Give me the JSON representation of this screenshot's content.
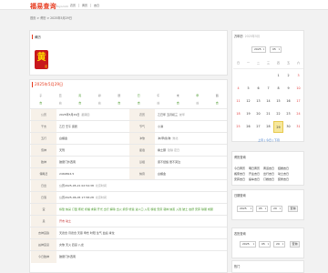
{
  "site": {
    "logo": "福易查询",
    "logo_sub": "fuyi.com",
    "nav": [
      "农历",
      "黄历",
      "吉日"
    ]
  },
  "breadcrumb": "首页 > 黄历 > 2025年5月29日",
  "header": {
    "title": "黄历",
    "badge_main": "黄",
    "badge_sub": "历",
    "text": "农历日历 今日宜忌 吉时凶时 彭祖百忌 胎神占方 五行纳音 冲煞方位 值神星宿",
    "link_text": "2025年5月29日",
    "more": "查看详情"
  },
  "main": {
    "title": "2025年5月29日",
    "hours": {
      "top": [
        "子",
        "丑",
        "寅",
        "卯",
        "辰",
        "巳",
        "午",
        "未",
        "申",
        "酉"
      ],
      "bottom": [
        "吉",
        "凶",
        "吉",
        "凶",
        "吉",
        "吉",
        "凶",
        "吉",
        "凶",
        "吉"
      ]
    },
    "rows": [
      {
        "l1": "公历",
        "v1": "2025年5月29日",
        "v1s": "星期四",
        "l2": "农历",
        "v2": "乙巳年 五月初三",
        "v2s": "蛇年"
      },
      {
        "l1": "干支",
        "v1": "乙巳 壬午 庚辰",
        "l2": "节气",
        "v2": "小满"
      },
      {
        "l1": "五行",
        "v1": "白蜡金",
        "l2": "冲煞",
        "v2": "冲(甲戌)狗",
        "v2s": "煞北"
      },
      {
        "l1": "值神",
        "v1": "天刑",
        "l2": "星宿",
        "v2": "柳土獐",
        "v2s": "建除 定日"
      },
      {
        "l1": "胎神",
        "v1": "碓磨门外西南",
        "l2": "彭祖",
        "v2": "庚不经络 辰不哭泣"
      },
      {
        "l1": "儒略日",
        "v1": "2460824.5",
        "l2": "纳音",
        "v2": "白蜡金"
      },
      {
        "l1": "日出",
        "v1": "公历2025-05-21 02:54:38",
        "v1s": "北京时间"
      },
      {
        "l1": "日落",
        "v1": "公历2025-06-05 17:58:28",
        "v1s": "北京时间"
      },
      {
        "l1": "宜",
        "v1": "嫁娶 纳采 订盟 祭祀 祈福 求嗣 开光 出行 解除 出火 拆卸 修造 进人口 入宅 移徙 安床 栽种 纳畜 入殓 破土 启攒 安葬 除服 成服"
      },
      {
        "l1": "忌",
        "v1": "开市 动土"
      },
      {
        "l1": "吉神宜趋",
        "v1": "天德合 月德合 天恩 母仓 时阳 生气 益后 青龙"
      },
      {
        "l1": "凶神宜忌",
        "v1": "灾煞 天火 四忌 八龙"
      },
      {
        "l1": "今日胎神",
        "v1": "碓磨门外西南"
      }
    ]
  },
  "calendar": {
    "title": "万年历",
    "subtitle": "2025年5月",
    "year": "2025",
    "month": "05",
    "weekdays": [
      "日",
      "一",
      "二",
      "三",
      "四",
      "五",
      "六"
    ],
    "days": [
      [
        "",
        "",
        "",
        "",
        "1",
        "2",
        "3"
      ],
      [
        "4",
        "5",
        "6",
        "7",
        "8",
        "9",
        "10"
      ],
      [
        "11",
        "12",
        "13",
        "14",
        "15",
        "16",
        "17"
      ],
      [
        "18",
        "19",
        "20",
        "21",
        "22",
        "23",
        "24"
      ],
      [
        "25",
        "26",
        "27",
        "28",
        "29",
        "30",
        "31"
      ]
    ],
    "today": "29",
    "footer_prev": "上月",
    "footer_today": "今日",
    "footer_next": "下月"
  },
  "tags": {
    "title": "黄历查询",
    "items": [
      "今日黄历",
      "明日黄历",
      "黄道吉日",
      "结婚吉日",
      "搬家吉日",
      "开业吉日",
      "出行吉日",
      "动土吉日",
      "安葬吉日",
      "提车吉日",
      "订婚吉日",
      "装修吉日"
    ]
  },
  "date_pick": {
    "title": "日期查询",
    "year": "2025",
    "month": "05",
    "day": "29",
    "btn": "查询"
  },
  "date_pick2": {
    "title": "农历查询",
    "year": "2025",
    "month": "05",
    "day": "29",
    "btn": "查询"
  },
  "side5": {
    "title": "热门"
  },
  "colors": {
    "accent": "#e63a1e",
    "green": "#4a9a2c",
    "red": "#c02a2a",
    "today_bg": "#f6e79b"
  }
}
